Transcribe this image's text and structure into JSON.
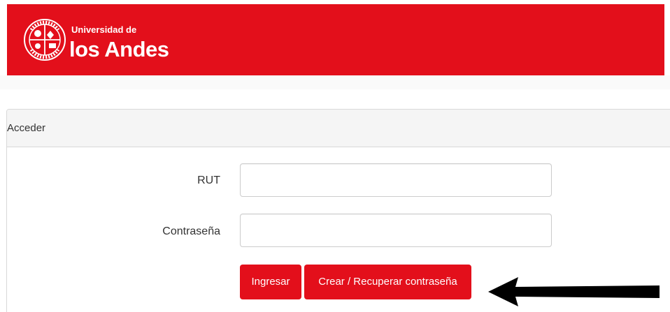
{
  "header": {
    "brand_small": "Universidad de",
    "brand_large": "los Andes",
    "brand_color": "#e30f1b",
    "seal_text": "UNIVERSIDAD DE LOS ANDES CHILE",
    "seal_icon": "university-seal-icon"
  },
  "card": {
    "title": "Acceder"
  },
  "form": {
    "rut_label": "RUT",
    "rut_value": "",
    "password_label": "Contraseña",
    "password_value": ""
  },
  "buttons": {
    "login_label": "Ingresar",
    "recover_label": "Crear / Recuperar contraseña"
  },
  "annotation": {
    "arrow_icon": "left-arrow-icon",
    "arrow_color": "#000000"
  }
}
